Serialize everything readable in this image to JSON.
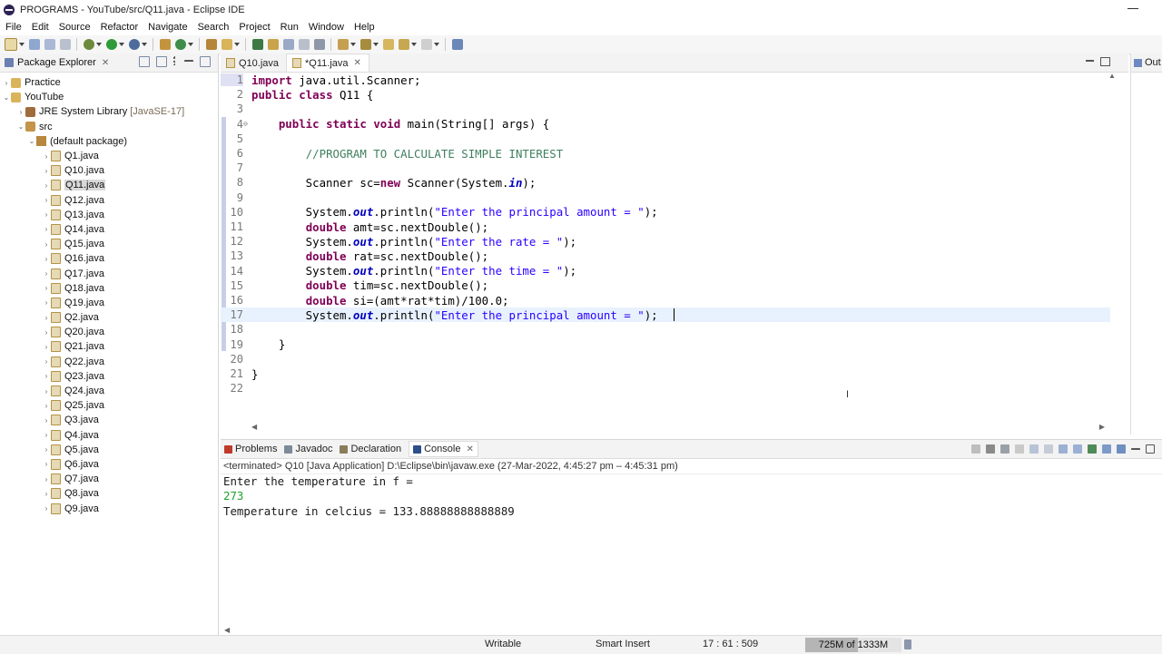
{
  "window": {
    "title": "PROGRAMS - YouTube/src/Q11.java - Eclipse IDE"
  },
  "menu": [
    "File",
    "Edit",
    "Source",
    "Refactor",
    "Navigate",
    "Search",
    "Project",
    "Run",
    "Window",
    "Help"
  ],
  "package_explorer": {
    "title": "Package Explorer",
    "projects": [
      {
        "name": "Practice"
      },
      {
        "name": "YouTube"
      }
    ],
    "library": {
      "name": "JRE System Library",
      "version": "[JavaSE-17]"
    },
    "src": "src",
    "package": "(default package)",
    "files": [
      "Q1.java",
      "Q10.java",
      "Q11.java",
      "Q12.java",
      "Q13.java",
      "Q14.java",
      "Q15.java",
      "Q16.java",
      "Q17.java",
      "Q18.java",
      "Q19.java",
      "Q2.java",
      "Q20.java",
      "Q21.java",
      "Q22.java",
      "Q23.java",
      "Q24.java",
      "Q25.java",
      "Q3.java",
      "Q4.java",
      "Q5.java",
      "Q6.java",
      "Q7.java",
      "Q8.java",
      "Q9.java"
    ],
    "selected_file": "Q11.java"
  },
  "editor": {
    "tabs": [
      {
        "label": "Q10.java",
        "active": false
      },
      {
        "label": "*Q11.java",
        "active": true
      }
    ],
    "lines": [
      {
        "n": "1",
        "code": "import java.util.Scanner;"
      },
      {
        "n": "2",
        "code": "public class Q11 {"
      },
      {
        "n": "3",
        "code": ""
      },
      {
        "n": "4",
        "code": "    public static void main(String[] args) {"
      },
      {
        "n": "5",
        "code": ""
      },
      {
        "n": "6",
        "code": "        //PROGRAM TO CALCULATE SIMPLE INTEREST"
      },
      {
        "n": "7",
        "code": ""
      },
      {
        "n": "8",
        "code": "        Scanner sc=new Scanner(System.in);"
      },
      {
        "n": "9",
        "code": ""
      },
      {
        "n": "10",
        "code": "        System.out.println(\"Enter the principal amount = \");"
      },
      {
        "n": "11",
        "code": "        double amt=sc.nextDouble();"
      },
      {
        "n": "12",
        "code": "        System.out.println(\"Enter the rate = \");"
      },
      {
        "n": "13",
        "code": "        double rat=sc.nextDouble();"
      },
      {
        "n": "14",
        "code": "        System.out.println(\"Enter the time = \");"
      },
      {
        "n": "15",
        "code": "        double tim=sc.nextDouble();"
      },
      {
        "n": "16",
        "code": "        double si=(amt*rat*tim)/100.0;"
      },
      {
        "n": "17",
        "code": "        System.out.println(\"Enter the principal amount = \");"
      },
      {
        "n": "18",
        "code": ""
      },
      {
        "n": "19",
        "code": "    }"
      },
      {
        "n": "20",
        "code": ""
      },
      {
        "n": "21",
        "code": "}"
      },
      {
        "n": "22",
        "code": ""
      }
    ],
    "current_line": "17"
  },
  "outline": {
    "label": "Out"
  },
  "console": {
    "tabs": [
      {
        "label": "Problems",
        "active": false,
        "color": "#c0392b"
      },
      {
        "label": "Javadoc",
        "active": false,
        "color": "#7d8a99"
      },
      {
        "label": "Declaration",
        "active": false,
        "color": "#8a7d5a"
      },
      {
        "label": "Console",
        "active": true,
        "color": "#2d4f8a"
      }
    ],
    "description": "<terminated> Q10 [Java Application] D:\\Eclipse\\bin\\javaw.exe  (27-Mar-2022, 4:45:27 pm – 4:45:31 pm)",
    "output": [
      {
        "text": "Enter the temperature in f = ",
        "input": false
      },
      {
        "text": "273",
        "input": true
      },
      {
        "text": "Temperature in celcius = 133.88888888888889",
        "input": false
      }
    ]
  },
  "status": {
    "writable": "Writable",
    "insert_mode": "Smart Insert",
    "position": "17 : 61 : 509",
    "heap": "725M of 1333M",
    "heap_used_fraction": 0.544
  }
}
